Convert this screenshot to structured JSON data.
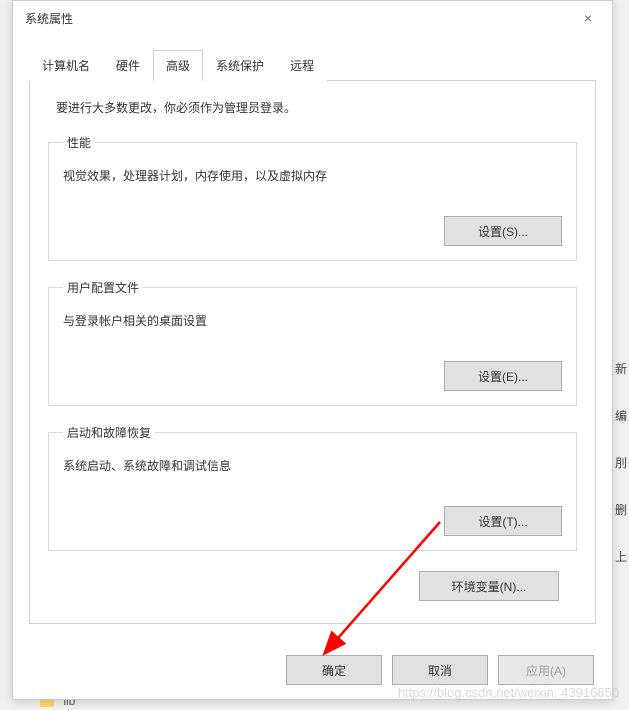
{
  "window": {
    "title": "系统属性",
    "close_icon": "×"
  },
  "tabs": [
    {
      "label": "计算机名"
    },
    {
      "label": "硬件"
    },
    {
      "label": "高级"
    },
    {
      "label": "系统保护"
    },
    {
      "label": "远程"
    }
  ],
  "activeTab": 2,
  "advanced": {
    "admin_notice": "要进行大多数更改，你必须作为管理员登录。",
    "performance": {
      "legend": "性能",
      "desc": "视觉效果，处理器计划，内存使用，以及虚拟内存",
      "button": "设置(S)..."
    },
    "user_profiles": {
      "legend": "用户配置文件",
      "desc": "与登录帐户相关的桌面设置",
      "button": "设置(E)..."
    },
    "startup": {
      "legend": "启动和故障恢复",
      "desc": "系统启动、系统故障和调试信息",
      "button": "设置(T)..."
    },
    "env_button": "环境变量(N)..."
  },
  "footer": {
    "ok": "确定",
    "cancel": "取消",
    "apply": "应用(A)"
  },
  "background": {
    "sidebar_chars": [
      "新",
      "编",
      "刖",
      "删",
      "上"
    ],
    "lib_folder": "lib"
  },
  "watermark": "https://blog.csdn.net/weixin_43916850"
}
